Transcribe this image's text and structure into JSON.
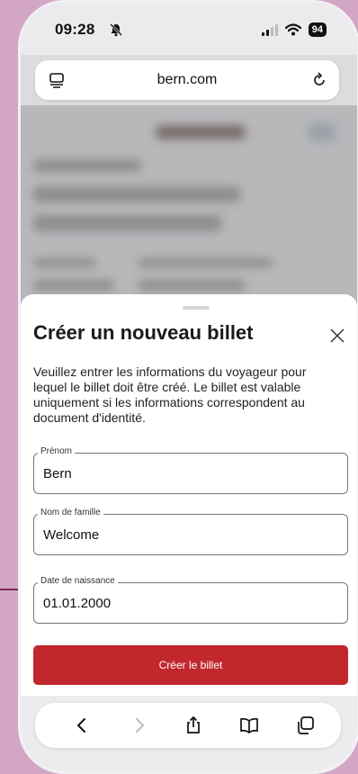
{
  "status_bar": {
    "time": "09:28",
    "battery": "94"
  },
  "browser": {
    "url": "bern.com"
  },
  "sheet": {
    "title": "Créer un nouveau billet",
    "description": "Veuillez entrer les informations du voyageur pour lequel le billet doit être créé. Le billet est valable uniquement si les informations correspondent au document d'identité.",
    "fields": [
      {
        "label": "Prénom",
        "value": "Bern"
      },
      {
        "label": "Nom de famille",
        "value": "Welcome"
      },
      {
        "label": "Date de naissance",
        "value": "01.01.2000"
      }
    ],
    "submit_label": "Créer le billet"
  },
  "colors": {
    "accent": "#c1272d",
    "background": "#d4a6c6"
  },
  "toolbar_icons": [
    "back-icon",
    "forward-icon",
    "share-icon",
    "bookmarks-icon",
    "tabs-icon"
  ]
}
